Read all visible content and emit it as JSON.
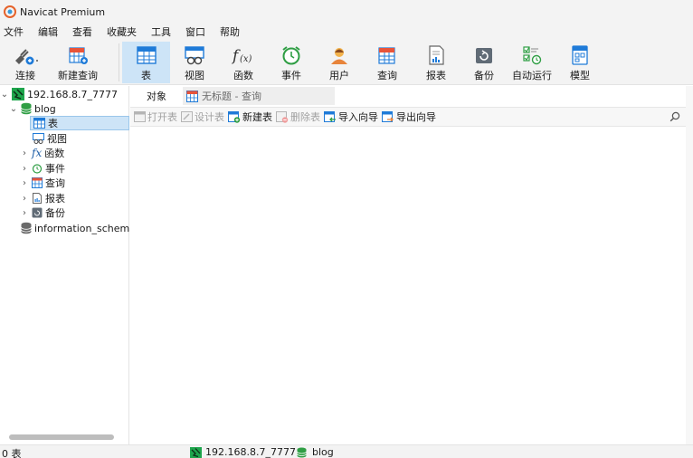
{
  "window": {
    "title": "Navicat Premium"
  },
  "menu": [
    "文件",
    "编辑",
    "查看",
    "收藏夹",
    "工具",
    "窗口",
    "帮助"
  ],
  "toolbar": {
    "connect": "连接",
    "new_query": "新建查询",
    "table": "表",
    "view": "视图",
    "function": "函数",
    "event": "事件",
    "user": "用户",
    "query": "查询",
    "report": "报表",
    "backup": "备份",
    "automation": "自动运行",
    "model": "模型",
    "active": "table"
  },
  "tree": {
    "connection": "192.168.8.7_7777",
    "database": "blog",
    "items": [
      "表",
      "视图",
      "函数",
      "事件",
      "查询",
      "报表",
      "备份"
    ],
    "selected": "表",
    "other_database": "information_schema",
    "fx_glyph": "fx"
  },
  "tabs": {
    "objects": "对象",
    "query": "无标题 - 查询"
  },
  "object_toolbar": {
    "open_table": "打开表",
    "design_table": "设计表",
    "new_table": "新建表",
    "delete_table": "删除表",
    "import_wizard": "导入向导",
    "export_wizard": "导出向导"
  },
  "status": {
    "count": "0 表",
    "connection": "192.168.8.7_7777",
    "database": "blog"
  },
  "colors": {
    "accent": "#1f7bd8",
    "selection": "#cde4f7",
    "connection_green": "#1ea54c",
    "database_green": "#2f9e44"
  }
}
